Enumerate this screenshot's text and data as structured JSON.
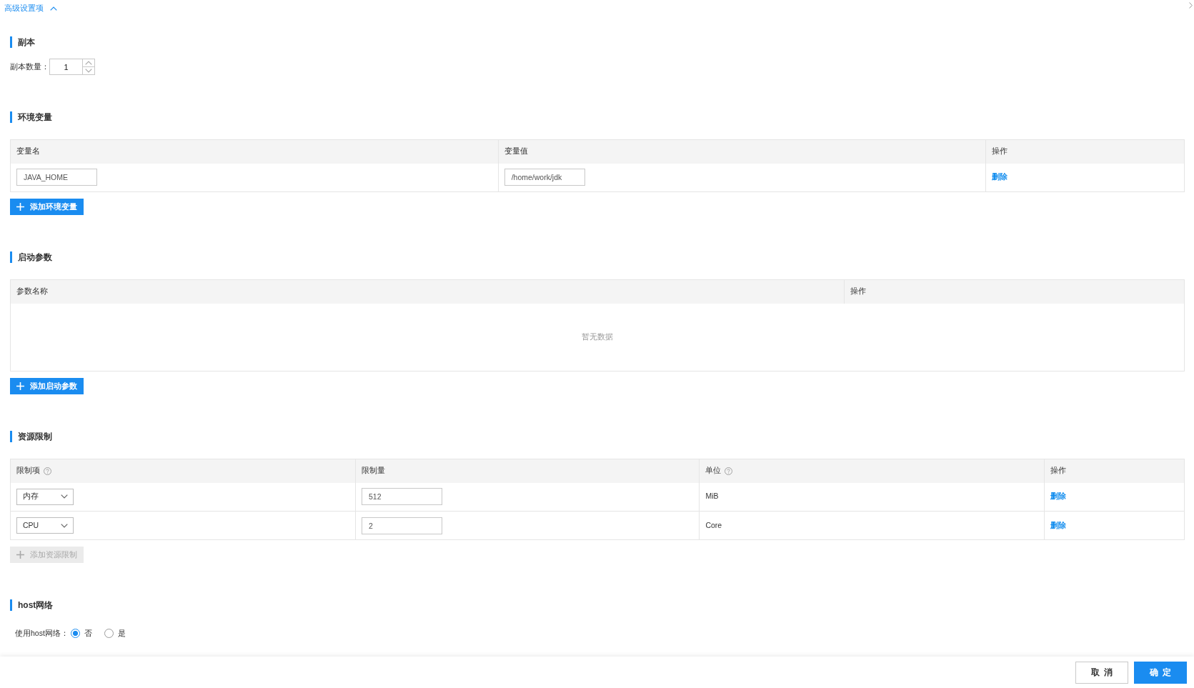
{
  "advanced_toggle": {
    "label": "高级设置项",
    "expanded": true
  },
  "sections": [
    {
      "kind": "number",
      "title": "副本",
      "label": "副本数量：",
      "value": "1"
    },
    {
      "kind": "table",
      "title": "环境变量",
      "columns": [
        {
          "label": "变量名"
        },
        {
          "label": "变量值"
        },
        {
          "label": "操作"
        }
      ],
      "rows": [
        {
          "cells": [
            {
              "kind": "input",
              "value": "JAVA_HOME"
            },
            {
              "kind": "input",
              "value": "/home/work/jdk"
            },
            {
              "kind": "link",
              "text": "删除"
            }
          ]
        }
      ],
      "add_button": {
        "label": "添加环境变量",
        "disabled": false
      }
    },
    {
      "kind": "table",
      "title": "启动参数",
      "columns": [
        {
          "label": "参数名称"
        },
        {
          "label": "操作"
        }
      ],
      "empty_text": "暂无数据",
      "add_button": {
        "label": "添加启动参数",
        "disabled": false
      }
    },
    {
      "kind": "table",
      "title": "资源限制",
      "columns": [
        {
          "label": "限制项",
          "help": true
        },
        {
          "label": "限制量",
          "help": false
        },
        {
          "label": "单位",
          "help": true
        },
        {
          "label": "操作",
          "help": false
        }
      ],
      "rows": [
        {
          "cells": [
            {
              "kind": "select",
              "value": "内存"
            },
            {
              "kind": "input",
              "value": "512"
            },
            {
              "kind": "text",
              "text": "MiB"
            },
            {
              "kind": "link",
              "text": "删除"
            }
          ]
        },
        {
          "cells": [
            {
              "kind": "select",
              "value": "CPU"
            },
            {
              "kind": "input",
              "value": "2"
            },
            {
              "kind": "text",
              "text": "Core"
            },
            {
              "kind": "link",
              "text": "删除"
            }
          ]
        }
      ],
      "add_button": {
        "label": "添加资源限制",
        "disabled": true
      }
    },
    {
      "kind": "radio",
      "title": "host网络",
      "label": "使用host网络：",
      "options": [
        {
          "label": "否",
          "selected": true
        },
        {
          "label": "是",
          "selected": false
        }
      ]
    }
  ],
  "footer_buttons": [
    {
      "label": "取消",
      "kind": "secondary"
    },
    {
      "label": "确定",
      "kind": "primary"
    }
  ]
}
